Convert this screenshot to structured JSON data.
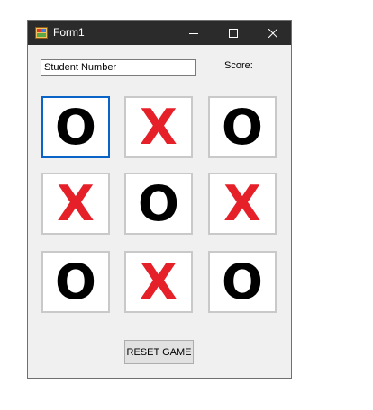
{
  "window": {
    "title": "Form1",
    "minimize_icon": "minimize-icon",
    "maximize_icon": "maximize-icon",
    "close_icon": "close-icon"
  },
  "student_number": {
    "value": "Student Number"
  },
  "score": {
    "label": "Score:"
  },
  "board": {
    "cells": [
      "O",
      "X",
      "O",
      "X",
      "O",
      "X",
      "O",
      "X",
      "O"
    ],
    "selected_index": 0,
    "colors": {
      "O": "#000000",
      "X": "#e52028"
    }
  },
  "reset": {
    "label": "RESET GAME"
  }
}
